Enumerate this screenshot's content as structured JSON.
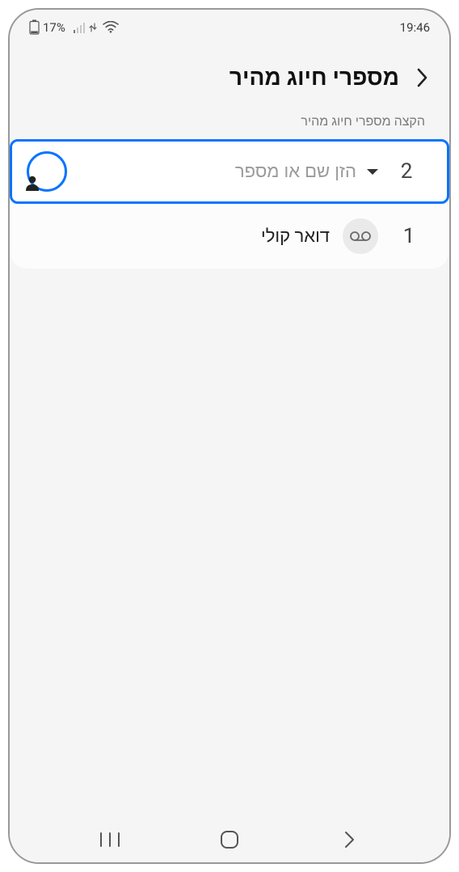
{
  "status": {
    "battery_percent": "17%",
    "clock": "19:46"
  },
  "header": {
    "title": "מספרי חיוג מהיר"
  },
  "subtitle": "הקצה מספרי חיוג מהיר",
  "rows": {
    "slot2": {
      "number": "2",
      "placeholder": "הזן שם או מספר"
    },
    "slot1": {
      "number": "1",
      "label": "דואר קולי"
    }
  }
}
